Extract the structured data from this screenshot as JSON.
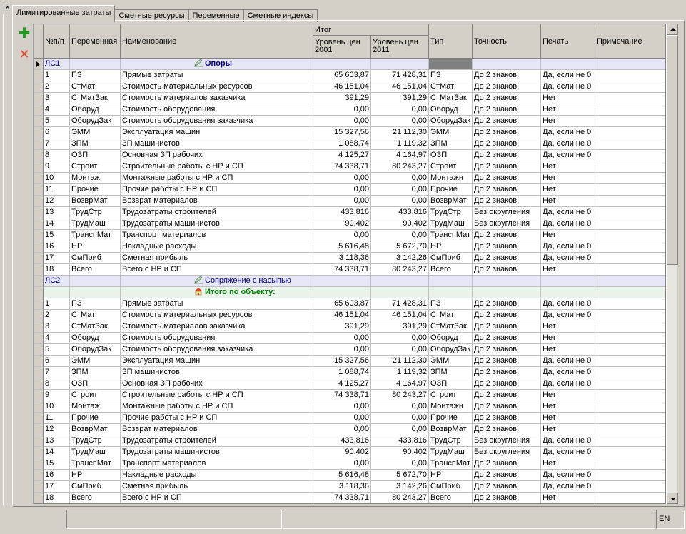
{
  "tabs": [
    "Лимитированные затраты",
    "Сметные ресурсы",
    "Переменные",
    "Сметные индексы"
  ],
  "active_tab": 0,
  "toolbar": {
    "add_icon": "plus-icon",
    "delete_icon": "cross-icon"
  },
  "columns": {
    "num": "№п/п",
    "var": "Переменная",
    "name": "Наименование",
    "total": "Итог",
    "level2001": "Уровень цен\n2001",
    "level2011": "Уровень цен\n2011",
    "type": "Тип",
    "precision": "Точность",
    "print": "Печать",
    "note": "Примечание"
  },
  "sections": [
    {
      "code": "ЛС1",
      "title": "Опоры",
      "icon": "pencil-icon",
      "bold": true,
      "rows": [
        [
          "1",
          "ПЗ",
          "Прямые затраты",
          "65 603,87",
          "71 428,31",
          "ПЗ",
          "До 2 знаков",
          "Да, если не 0",
          ""
        ],
        [
          "2",
          "СтМат",
          "Стоимость материальных ресурсов",
          "46 151,04",
          "46 151,04",
          "СтМат",
          "До 2 знаков",
          "Да, если не 0",
          ""
        ],
        [
          "3",
          "СтМатЗак",
          "Стоимость материалов заказчика",
          "391,29",
          "391,29",
          "СтМатЗак",
          "До 2 знаков",
          "Нет",
          ""
        ],
        [
          "4",
          "Оборуд",
          "Стоимость оборудования",
          "0,00",
          "0,00",
          "Оборуд",
          "До 2 знаков",
          "Нет",
          ""
        ],
        [
          "5",
          "ОборудЗак",
          "Стоимость оборудования заказчика",
          "0,00",
          "0,00",
          "ОборудЗак",
          "До 2 знаков",
          "Нет",
          ""
        ],
        [
          "6",
          "ЭММ",
          "Эксплуатация машин",
          "15 327,56",
          "21 112,30",
          "ЭММ",
          "До 2 знаков",
          "Да, если не 0",
          ""
        ],
        [
          "7",
          "ЗПМ",
          "ЗП машинистов",
          "1 088,74",
          "1 119,32",
          "ЗПМ",
          "До 2 знаков",
          "Да, если не 0",
          ""
        ],
        [
          "8",
          "ОЗП",
          "Основная ЗП рабочих",
          "4 125,27",
          "4 164,97",
          "ОЗП",
          "До 2 знаков",
          "Да, если не 0",
          ""
        ],
        [
          "9",
          "Строит",
          "Строительные работы с НР и СП",
          "74 338,71",
          "80 243,27",
          "Строит",
          "До 2 знаков",
          "Нет",
          ""
        ],
        [
          "10",
          "Монтаж",
          "Монтажные работы с НР и СП",
          "0,00",
          "0,00",
          "Монтажн",
          "До 2 знаков",
          "Нет",
          ""
        ],
        [
          "11",
          "Прочие",
          "Прочие работы с НР и СП",
          "0,00",
          "0,00",
          "Прочие",
          "До 2 знаков",
          "Нет",
          ""
        ],
        [
          "12",
          "ВозврМат",
          "Возврат материалов",
          "0,00",
          "0,00",
          "ВозврМат",
          "До 2 знаков",
          "Нет",
          ""
        ],
        [
          "13",
          "ТрудСтр",
          "Трудозатраты строителей",
          "433,816",
          "433,816",
          "ТрудСтр",
          "Без округления",
          "Да, если не 0",
          ""
        ],
        [
          "14",
          "ТрудМаш",
          "Трудозатраты машинистов",
          "90,402",
          "90,402",
          "ТрудМаш",
          "Без округления",
          "Да, если не 0",
          ""
        ],
        [
          "15",
          "ТранспМат",
          "Транспорт материалов",
          "0,00",
          "0,00",
          "ТранспМат",
          "До 2 знаков",
          "Нет",
          ""
        ],
        [
          "16",
          "НР",
          "Накладные расходы",
          "5 616,48",
          "5 672,70",
          "НР",
          "До 2 знаков",
          "Да, если не 0",
          ""
        ],
        [
          "17",
          "СмПриб",
          "Сметная прибыль",
          "3 118,36",
          "3 142,26",
          "СмПриб",
          "До 2 знаков",
          "Да, если не 0",
          ""
        ],
        [
          "18",
          "Всего",
          "Всего с НР и СП",
          "74 338,71",
          "80 243,27",
          "Всего",
          "До 2 знаков",
          "Нет",
          ""
        ]
      ]
    },
    {
      "code": "ЛС2",
      "title": "Сопряжение с насыпью",
      "icon": "pencil-icon",
      "bold": false,
      "rows": []
    },
    {
      "code": "",
      "title": "Итого по объекту:",
      "icon": "house-icon",
      "total": true,
      "rows": [
        [
          "1",
          "ПЗ",
          "Прямые затраты",
          "65 603,87",
          "71 428,31",
          "ПЗ",
          "До 2 знаков",
          "Да, если не 0",
          ""
        ],
        [
          "2",
          "СтМат",
          "Стоимость материальных ресурсов",
          "46 151,04",
          "46 151,04",
          "СтМат",
          "До 2 знаков",
          "Да, если не 0",
          ""
        ],
        [
          "3",
          "СтМатЗак",
          "Стоимость материалов заказчика",
          "391,29",
          "391,29",
          "СтМатЗак",
          "До 2 знаков",
          "Нет",
          ""
        ],
        [
          "4",
          "Оборуд",
          "Стоимость оборудования",
          "0,00",
          "0,00",
          "Оборуд",
          "До 2 знаков",
          "Нет",
          ""
        ],
        [
          "5",
          "ОборудЗак",
          "Стоимость оборудования заказчика",
          "0,00",
          "0,00",
          "ОборудЗак",
          "До 2 знаков",
          "Нет",
          ""
        ],
        [
          "6",
          "ЭММ",
          "Эксплуатация машин",
          "15 327,56",
          "21 112,30",
          "ЭММ",
          "До 2 знаков",
          "Да, если не 0",
          ""
        ],
        [
          "7",
          "ЗПМ",
          "ЗП машинистов",
          "1 088,74",
          "1 119,32",
          "ЗПМ",
          "До 2 знаков",
          "Да, если не 0",
          ""
        ],
        [
          "8",
          "ОЗП",
          "Основная ЗП рабочих",
          "4 125,27",
          "4 164,97",
          "ОЗП",
          "До 2 знаков",
          "Да, если не 0",
          ""
        ],
        [
          "9",
          "Строит",
          "Строительные работы с НР и СП",
          "74 338,71",
          "80 243,27",
          "Строит",
          "До 2 знаков",
          "Нет",
          ""
        ],
        [
          "10",
          "Монтаж",
          "Монтажные работы с НР и СП",
          "0,00",
          "0,00",
          "Монтажн",
          "До 2 знаков",
          "Нет",
          ""
        ],
        [
          "11",
          "Прочие",
          "Прочие работы с НР и СП",
          "0,00",
          "0,00",
          "Прочие",
          "До 2 знаков",
          "Нет",
          ""
        ],
        [
          "12",
          "ВозврМат",
          "Возврат материалов",
          "0,00",
          "0,00",
          "ВозврМат",
          "До 2 знаков",
          "Нет",
          ""
        ],
        [
          "13",
          "ТрудСтр",
          "Трудозатраты строителей",
          "433,816",
          "433,816",
          "ТрудСтр",
          "Без округления",
          "Да, если не 0",
          ""
        ],
        [
          "14",
          "ТрудМаш",
          "Трудозатраты машинистов",
          "90,402",
          "90,402",
          "ТрудМаш",
          "Без округления",
          "Да, если не 0",
          ""
        ],
        [
          "15",
          "ТранспМат",
          "Транспорт материалов",
          "0,00",
          "0,00",
          "ТранспМат",
          "До 2 знаков",
          "Нет",
          ""
        ],
        [
          "16",
          "НР",
          "Накладные расходы",
          "5 616,48",
          "5 672,70",
          "НР",
          "До 2 знаков",
          "Да, если не 0",
          ""
        ],
        [
          "17",
          "СмПриб",
          "Сметная прибыль",
          "3 118,36",
          "3 142,26",
          "СмПриб",
          "До 2 знаков",
          "Да, если не 0",
          ""
        ],
        [
          "18",
          "Всего",
          "Всего с НР и СП",
          "74 338,71",
          "80 243,27",
          "Всего",
          "До 2 знаков",
          "Нет",
          ""
        ]
      ]
    }
  ],
  "status": {
    "lang": "EN"
  },
  "colors": {
    "section_bg": "#e6e6f7",
    "section_text": "#000080",
    "total_bg": "#eaf4ea",
    "total_text": "#008000",
    "chrome": "#d4d0c8"
  }
}
